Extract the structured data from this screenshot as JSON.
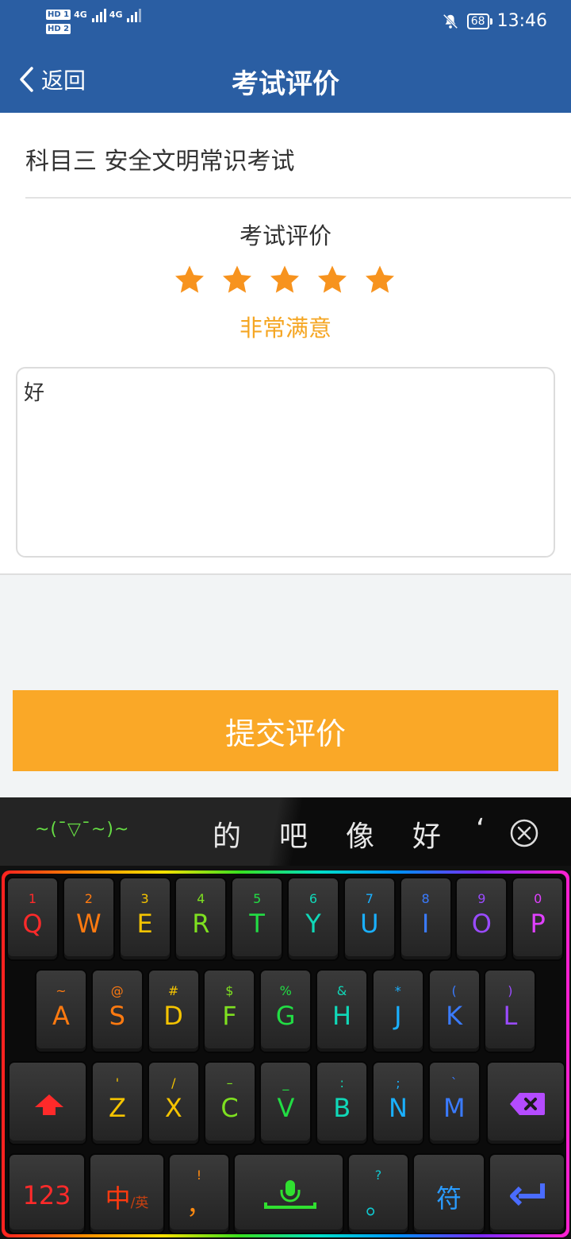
{
  "status_bar": {
    "time": "13:46",
    "battery": "68",
    "sim1": "HD 1",
    "sim2": "HD 2",
    "net1": "4G",
    "net2": "4G"
  },
  "header": {
    "back_label": "返回",
    "title": "考试评价"
  },
  "exam": {
    "name": "科目三 安全文明常识考试"
  },
  "rating": {
    "title": "考试评价",
    "stars": 5,
    "max_stars": 5,
    "label": "非常满意",
    "star_color": "#f7931e"
  },
  "comment": {
    "value": "好"
  },
  "submit": {
    "label": "提交评价",
    "color": "#faa827"
  },
  "keyboard": {
    "emoticon": "~(ˉ▽ˉ~)~",
    "candidates": [
      "的",
      "吧",
      "像",
      "好",
      "‘"
    ],
    "row1": [
      {
        "sub": "1",
        "main": "Q"
      },
      {
        "sub": "2",
        "main": "W"
      },
      {
        "sub": "3",
        "main": "E"
      },
      {
        "sub": "4",
        "main": "R"
      },
      {
        "sub": "5",
        "main": "T"
      },
      {
        "sub": "6",
        "main": "Y"
      },
      {
        "sub": "7",
        "main": "U"
      },
      {
        "sub": "8",
        "main": "I"
      },
      {
        "sub": "9",
        "main": "O"
      },
      {
        "sub": "0",
        "main": "P"
      }
    ],
    "row2": [
      {
        "sub": "~",
        "main": "A"
      },
      {
        "sub": "@",
        "main": "S"
      },
      {
        "sub": "#",
        "main": "D"
      },
      {
        "sub": "$",
        "main": "F"
      },
      {
        "sub": "%",
        "main": "G"
      },
      {
        "sub": "&",
        "main": "H"
      },
      {
        "sub": "*",
        "main": "J"
      },
      {
        "sub": "(",
        "main": "K"
      },
      {
        "sub": ")",
        "main": "L"
      }
    ],
    "row3": [
      {
        "sub": "'",
        "main": "Z"
      },
      {
        "sub": "/",
        "main": "X"
      },
      {
        "sub": "–",
        "main": "C"
      },
      {
        "sub": "_",
        "main": "V"
      },
      {
        "sub": ":",
        "main": "B"
      },
      {
        "sub": ";",
        "main": "N"
      },
      {
        "sub": "`",
        "main": "M"
      }
    ],
    "num_key": "123",
    "lang_key": "中",
    "lang_key_sub": "/英",
    "punct_key_sub": "!",
    "punct_key": "，",
    "dot_key_sub": "?",
    "dot_key": "。",
    "symbol_key": "符"
  }
}
